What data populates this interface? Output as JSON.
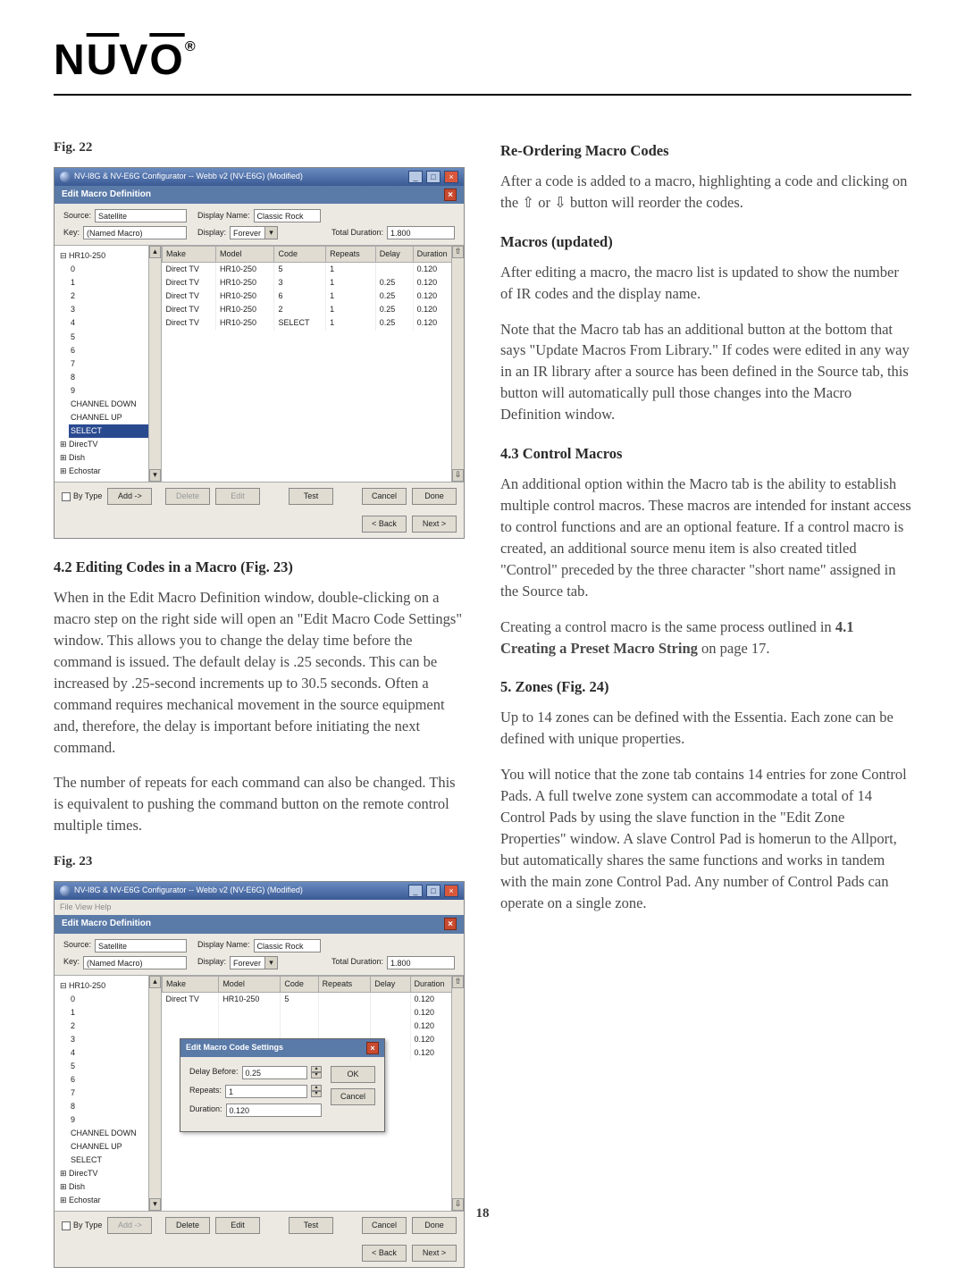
{
  "logo": "NUVO",
  "page_number": "18",
  "left": {
    "fig22_label": "Fig. 22",
    "section_42": "4.2  Editing Codes in a Macro (Fig. 23)",
    "p_42a": "When in the Edit Macro Definition window, double-clicking on a macro step on the right side will open an \"Edit Macro Code Settings\" window. This allows you to change the delay time before the command is issued. The default delay is .25 seconds. This can be increased by .25-second increments up to 30.5 seconds. Often a command requires mechanical movement in the source equipment and, therefore, the delay is important before initiating the next command.",
    "p_42b": "The number of repeats for each command can also be changed. This is equivalent to pushing the command button on the remote control multiple times.",
    "fig23_label": "Fig. 23"
  },
  "right": {
    "h_reorder": "Re-Ordering Macro Codes",
    "p_reorder": "After a code is added to a macro, highlighting a code and clicking on the ⇧ or ⇩ button will reorder the codes.",
    "h_macros": "Macros (updated)",
    "p_macros_a": "After editing a macro, the macro list is updated to show the number of IR codes and the display name.",
    "p_macros_b": "Note that the Macro tab has an additional button at the bottom that says \"Update Macros From Library.\" If codes were edited in any way in an IR library after a source has been defined in the Source tab, this button will automatically pull those changes into the Macro Definition window.",
    "h_43": "4.3  Control Macros",
    "p_43a": "An additional option within the Macro tab is the ability to establish multiple control macros. These macros are intended for instant access to control functions and are an optional feature. If a control macro is created, an additional source menu item is also created titled \"Control\" preceded by the three character \"short name\" assigned in the Source tab.",
    "p_43b_a": "Creating a control macro is the same process outlined in ",
    "p_43b_b": "4.1 Creating a Preset Macro String",
    "p_43b_c": " on page 17.",
    "h_5": "5. Zones (Fig. 24)",
    "p_5a": "Up to 14 zones can be defined with the Essentia. Each zone can be defined with unique properties.",
    "p_5b": "You will notice that the zone tab contains 14 entries for zone Control Pads. A full twelve zone system can accommodate a total of 14 Control Pads by using the slave function in the \"Edit Zone Properties\" window. A slave Control Pad is homerun to the Allport, but automatically shares the same functions and works in tandem with the main zone Control Pad. Any number of Control Pads can operate on a single zone."
  },
  "fig22": {
    "win_title": "NV-I8G & NV-E6G Configurator -- Webb v2 (NV-E6G) (Modified)",
    "panel_title": "Edit Macro Definition",
    "labels": {
      "source": "Source:",
      "display_name": "Display Name:",
      "key": "Key:",
      "display": "Display:",
      "total_duration": "Total Duration:"
    },
    "vals": {
      "source": "Satellite",
      "display_name": "Classic Rock",
      "key": "(Named Macro)",
      "display": "Forever",
      "total_duration": "1.800"
    },
    "tree": [
      "HR10-250",
      "0",
      "1",
      "2",
      "3",
      "4",
      "5",
      "6",
      "7",
      "8",
      "9",
      "CHANNEL DOWN",
      "CHANNEL UP",
      "SELECT",
      "DirecTV",
      "Dish",
      "Echostar"
    ],
    "tree_selected": "SELECT",
    "cols": [
      "Make",
      "Model",
      "Code",
      "Repeats",
      "Delay",
      "Duration"
    ],
    "rows": [
      [
        "Direct TV",
        "HR10-250",
        "5",
        "1",
        "",
        "0.120"
      ],
      [
        "Direct TV",
        "HR10-250",
        "3",
        "1",
        "0.25",
        "0.120"
      ],
      [
        "Direct TV",
        "HR10-250",
        "6",
        "1",
        "0.25",
        "0.120"
      ],
      [
        "Direct TV",
        "HR10-250",
        "2",
        "1",
        "0.25",
        "0.120"
      ],
      [
        "Direct TV",
        "HR10-250",
        "SELECT",
        "1",
        "0.25",
        "0.120"
      ]
    ],
    "bytype": "By Type",
    "btns": {
      "add": "Add ->",
      "delete": "Delete",
      "edit": "Edit",
      "test": "Test",
      "cancel": "Cancel",
      "done": "Done",
      "back": "< Back",
      "next": "Next >"
    }
  },
  "fig23": {
    "win_title": "NV-I8G & NV-E6G Configurator -- Webb v2 (NV-E6G) (Modified)",
    "menu": "File  View  Help",
    "panel_title": "Edit Macro Definition",
    "labels": {
      "source": "Source:",
      "display_name": "Display Name:",
      "key": "Key:",
      "display": "Display:",
      "total_duration": "Total Duration:"
    },
    "vals": {
      "source": "Satellite",
      "display_name": "Classic Rock",
      "key": "(Named Macro)",
      "display": "Forever",
      "total_duration": "1.800"
    },
    "tree": [
      "HR10-250",
      "0",
      "1",
      "2",
      "3",
      "4",
      "5",
      "6",
      "7",
      "8",
      "9",
      "CHANNEL DOWN",
      "CHANNEL UP",
      "SELECT",
      "DirecTV",
      "Dish",
      "Echostar"
    ],
    "cols": [
      "Make",
      "Model",
      "Code",
      "Repeats",
      "Delay",
      "Duration"
    ],
    "row0": [
      "Direct TV",
      "HR10-250",
      "5"
    ],
    "durs": [
      "0.120",
      "0.120",
      "0.120",
      "0.120",
      "0.120"
    ],
    "dialog": {
      "title": "Edit Macro Code Settings",
      "delay_before": "Delay Before:",
      "delay_val": "0.25",
      "repeats": "Repeats:",
      "repeats_val": "1",
      "duration": "Duration:",
      "duration_val": "0.120",
      "ok": "OK",
      "cancel": "Cancel"
    },
    "bytype": "By Type",
    "btns": {
      "add": "Add ->",
      "delete": "Delete",
      "edit": "Edit",
      "test": "Test",
      "cancel": "Cancel",
      "done": "Done",
      "back": "< Back",
      "next": "Next >"
    }
  }
}
